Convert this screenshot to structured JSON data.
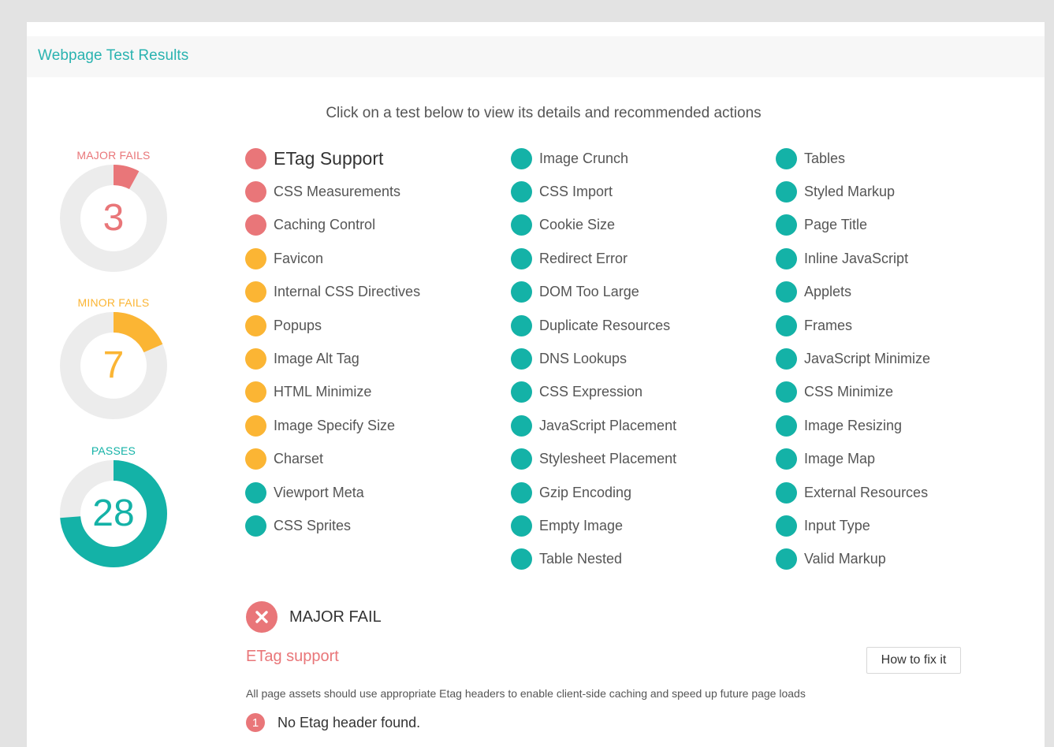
{
  "colors": {
    "major": "#e97679",
    "minor": "#fbb534",
    "pass": "#14b2a7",
    "track": "#ececec"
  },
  "header": {
    "title": "Webpage Test Results"
  },
  "instruction": "Click on a test below to view its details and recommended actions",
  "summary": [
    {
      "label": "MAJOR FAILS",
      "value": "3",
      "fraction": 0.0789,
      "color_key": "major"
    },
    {
      "label": "MINOR FAILS",
      "value": "7",
      "fraction": 0.1842,
      "color_key": "minor"
    },
    {
      "label": "PASSES",
      "value": "28",
      "fraction": 0.7368,
      "color_key": "pass"
    }
  ],
  "tests": {
    "column1": [
      {
        "label": "ETag Support",
        "status": "major",
        "selected": true
      },
      {
        "label": "CSS Measurements",
        "status": "major"
      },
      {
        "label": "Caching Control",
        "status": "major"
      },
      {
        "label": "Favicon",
        "status": "minor"
      },
      {
        "label": "Internal CSS Directives",
        "status": "minor"
      },
      {
        "label": "Popups",
        "status": "minor"
      },
      {
        "label": "Image Alt Tag",
        "status": "minor"
      },
      {
        "label": "HTML Minimize",
        "status": "minor"
      },
      {
        "label": "Image Specify Size",
        "status": "minor"
      },
      {
        "label": "Charset",
        "status": "minor"
      },
      {
        "label": "Viewport Meta",
        "status": "pass"
      },
      {
        "label": "CSS Sprites",
        "status": "pass"
      }
    ],
    "column2": [
      {
        "label": "Image Crunch",
        "status": "pass"
      },
      {
        "label": "CSS Import",
        "status": "pass"
      },
      {
        "label": "Cookie Size",
        "status": "pass"
      },
      {
        "label": "Redirect Error",
        "status": "pass"
      },
      {
        "label": "DOM Too Large",
        "status": "pass"
      },
      {
        "label": "Duplicate Resources",
        "status": "pass"
      },
      {
        "label": "DNS Lookups",
        "status": "pass"
      },
      {
        "label": "CSS Expression",
        "status": "pass"
      },
      {
        "label": "JavaScript Placement",
        "status": "pass"
      },
      {
        "label": "Stylesheet Placement",
        "status": "pass"
      },
      {
        "label": "Gzip Encoding",
        "status": "pass"
      },
      {
        "label": "Empty Image",
        "status": "pass"
      },
      {
        "label": "Table Nested",
        "status": "pass"
      }
    ],
    "column3": [
      {
        "label": "Tables",
        "status": "pass"
      },
      {
        "label": "Styled Markup",
        "status": "pass"
      },
      {
        "label": "Page Title",
        "status": "pass"
      },
      {
        "label": "Inline JavaScript",
        "status": "pass"
      },
      {
        "label": "Applets",
        "status": "pass"
      },
      {
        "label": "Frames",
        "status": "pass"
      },
      {
        "label": "JavaScript Minimize",
        "status": "pass"
      },
      {
        "label": "CSS Minimize",
        "status": "pass"
      },
      {
        "label": "Image Resizing",
        "status": "pass"
      },
      {
        "label": "Image Map",
        "status": "pass"
      },
      {
        "label": "External Resources",
        "status": "pass"
      },
      {
        "label": "Input Type",
        "status": "pass"
      },
      {
        "label": "Valid Markup",
        "status": "pass"
      }
    ]
  },
  "detail": {
    "icon": "close-circle-icon",
    "status": "MAJOR FAIL",
    "name": "ETag support",
    "fix_button": "How to fix it",
    "description": "All page assets should use appropriate Etag headers to enable client-side caching and speed up future page loads",
    "issues": [
      {
        "number": "1",
        "text": "No Etag header found."
      }
    ]
  }
}
